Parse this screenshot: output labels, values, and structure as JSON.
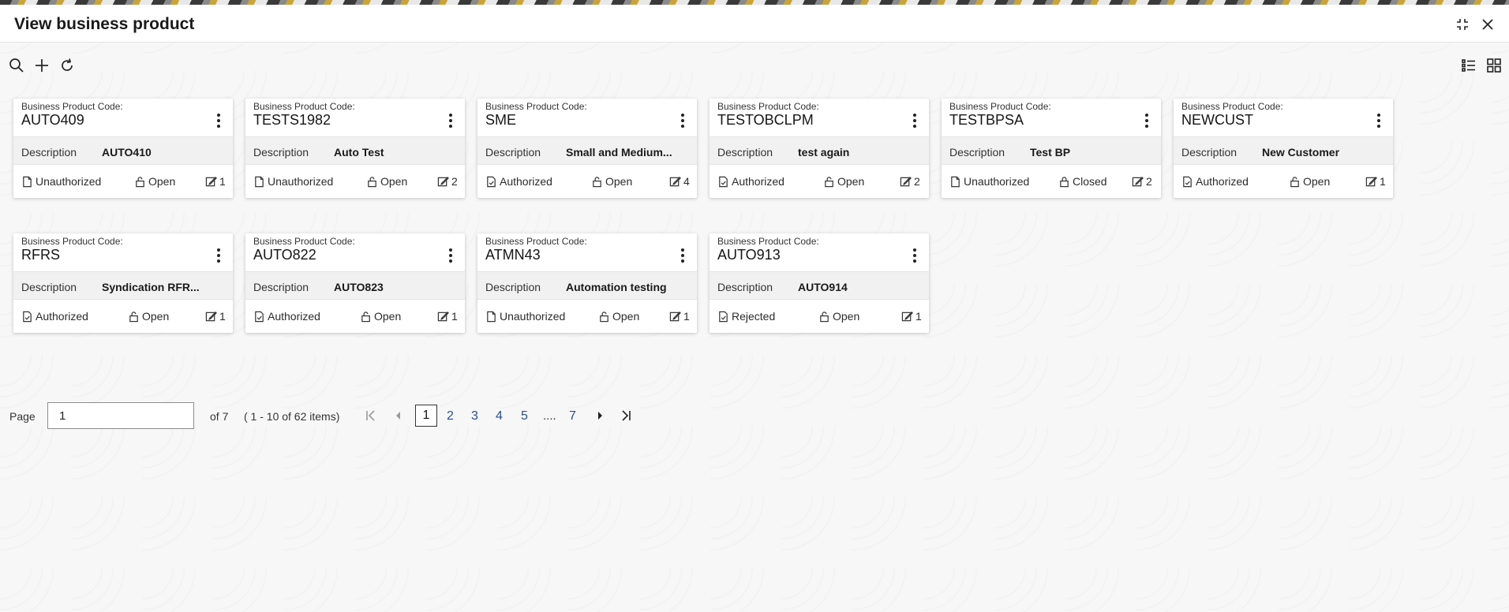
{
  "window": {
    "title": "View business product"
  },
  "card_common": {
    "code_label": "Business Product Code:",
    "desc_label": "Description"
  },
  "cards": [
    {
      "code": "AUTO409",
      "description": "AUTO410",
      "auth_status": "Unauthorized",
      "record_status": "Open",
      "version": "1"
    },
    {
      "code": "TESTS1982",
      "description": "Auto Test",
      "auth_status": "Unauthorized",
      "record_status": "Open",
      "version": "2"
    },
    {
      "code": "SME",
      "description": "Small and Medium...",
      "auth_status": "Authorized",
      "record_status": "Open",
      "version": "4"
    },
    {
      "code": "TESTOBCLPM",
      "description": "test again",
      "auth_status": "Authorized",
      "record_status": "Open",
      "version": "2"
    },
    {
      "code": "TESTBPSA",
      "description": "Test BP",
      "auth_status": "Unauthorized",
      "record_status": "Closed",
      "version": "2"
    },
    {
      "code": "NEWCUST",
      "description": "New Customer",
      "auth_status": "Authorized",
      "record_status": "Open",
      "version": "1"
    },
    {
      "code": "RFRS",
      "description": "Syndication RFR...",
      "auth_status": "Authorized",
      "record_status": "Open",
      "version": "1"
    },
    {
      "code": "AUTO822",
      "description": "AUTO823",
      "auth_status": "Authorized",
      "record_status": "Open",
      "version": "1"
    },
    {
      "code": "ATMN43",
      "description": "Automation testing",
      "auth_status": "Unauthorized",
      "record_status": "Open",
      "version": "1"
    },
    {
      "code": "AUTO913",
      "description": "AUTO914",
      "auth_status": "Rejected",
      "record_status": "Open",
      "version": "1"
    }
  ],
  "pagination": {
    "page_label": "Page",
    "current_page": "1",
    "of_label": "of 7",
    "items_label": "( 1 - 10 of 62 items)",
    "pages": [
      "1",
      "2",
      "3",
      "4",
      "5",
      "7"
    ],
    "ellipsis": "...."
  }
}
